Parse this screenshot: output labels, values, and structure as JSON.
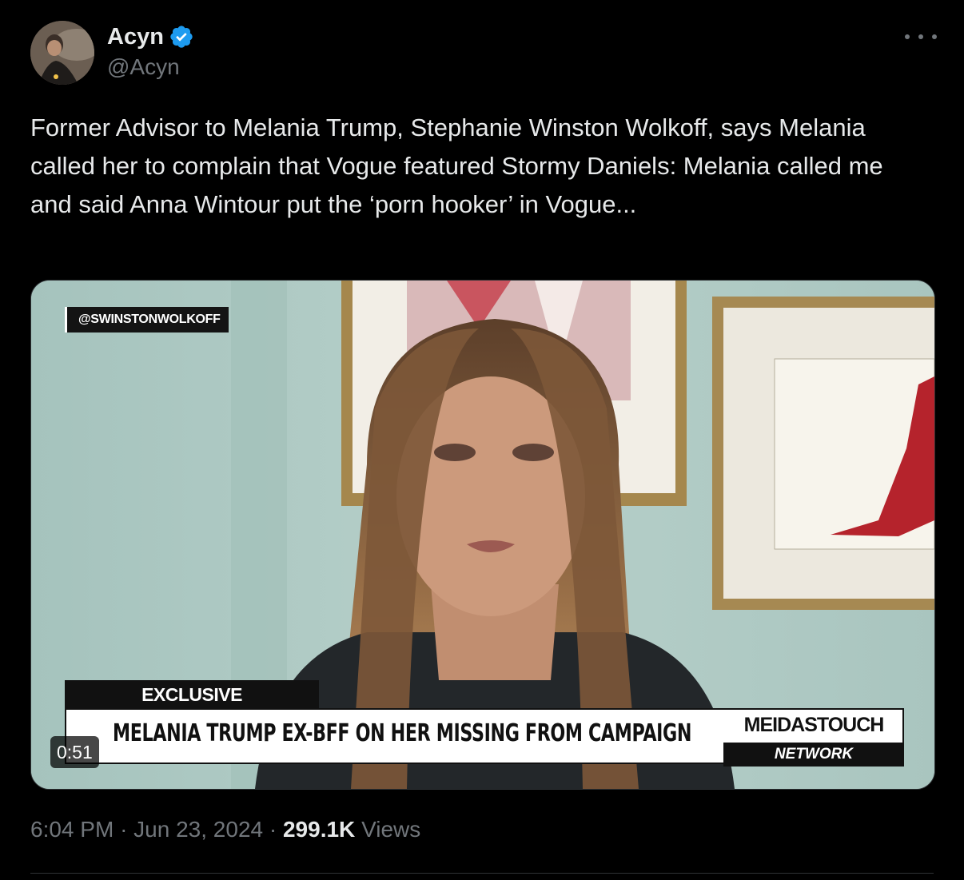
{
  "author": {
    "display_name": "Acyn",
    "handle": "@Acyn",
    "verified": true,
    "badge_color": "#1d9bf0"
  },
  "tweet": {
    "text": "Former Advisor to Melania Trump, Stephanie Winston Wolkoff, says Melania called her to complain that Vogue featured Stormy Daniels: Melania called me and said Anna Wintour put the ‘porn hooker’ in Vogue..."
  },
  "media": {
    "handle_tag": "@SWINSTONWOLKOFF",
    "exclusive_label": "EXCLUSIVE",
    "headline": "MELANIA TRUMP EX-BFF ON HER MISSING FROM CAMPAIGN",
    "brand_top": "MEIDASTOUCH",
    "brand_bottom": "NETWORK",
    "duration": "0:51"
  },
  "meta": {
    "time": "6:04 PM",
    "separator": "·",
    "date": "Jun 23, 2024",
    "views_count": "299.1K",
    "views_label": "Views"
  },
  "icons": {
    "more": "more-options-icon",
    "verified": "verified-badge-icon"
  },
  "colors": {
    "background": "#000000",
    "text_primary": "#e7e9ea",
    "text_secondary": "#71767b",
    "divider": "#2f3336"
  }
}
